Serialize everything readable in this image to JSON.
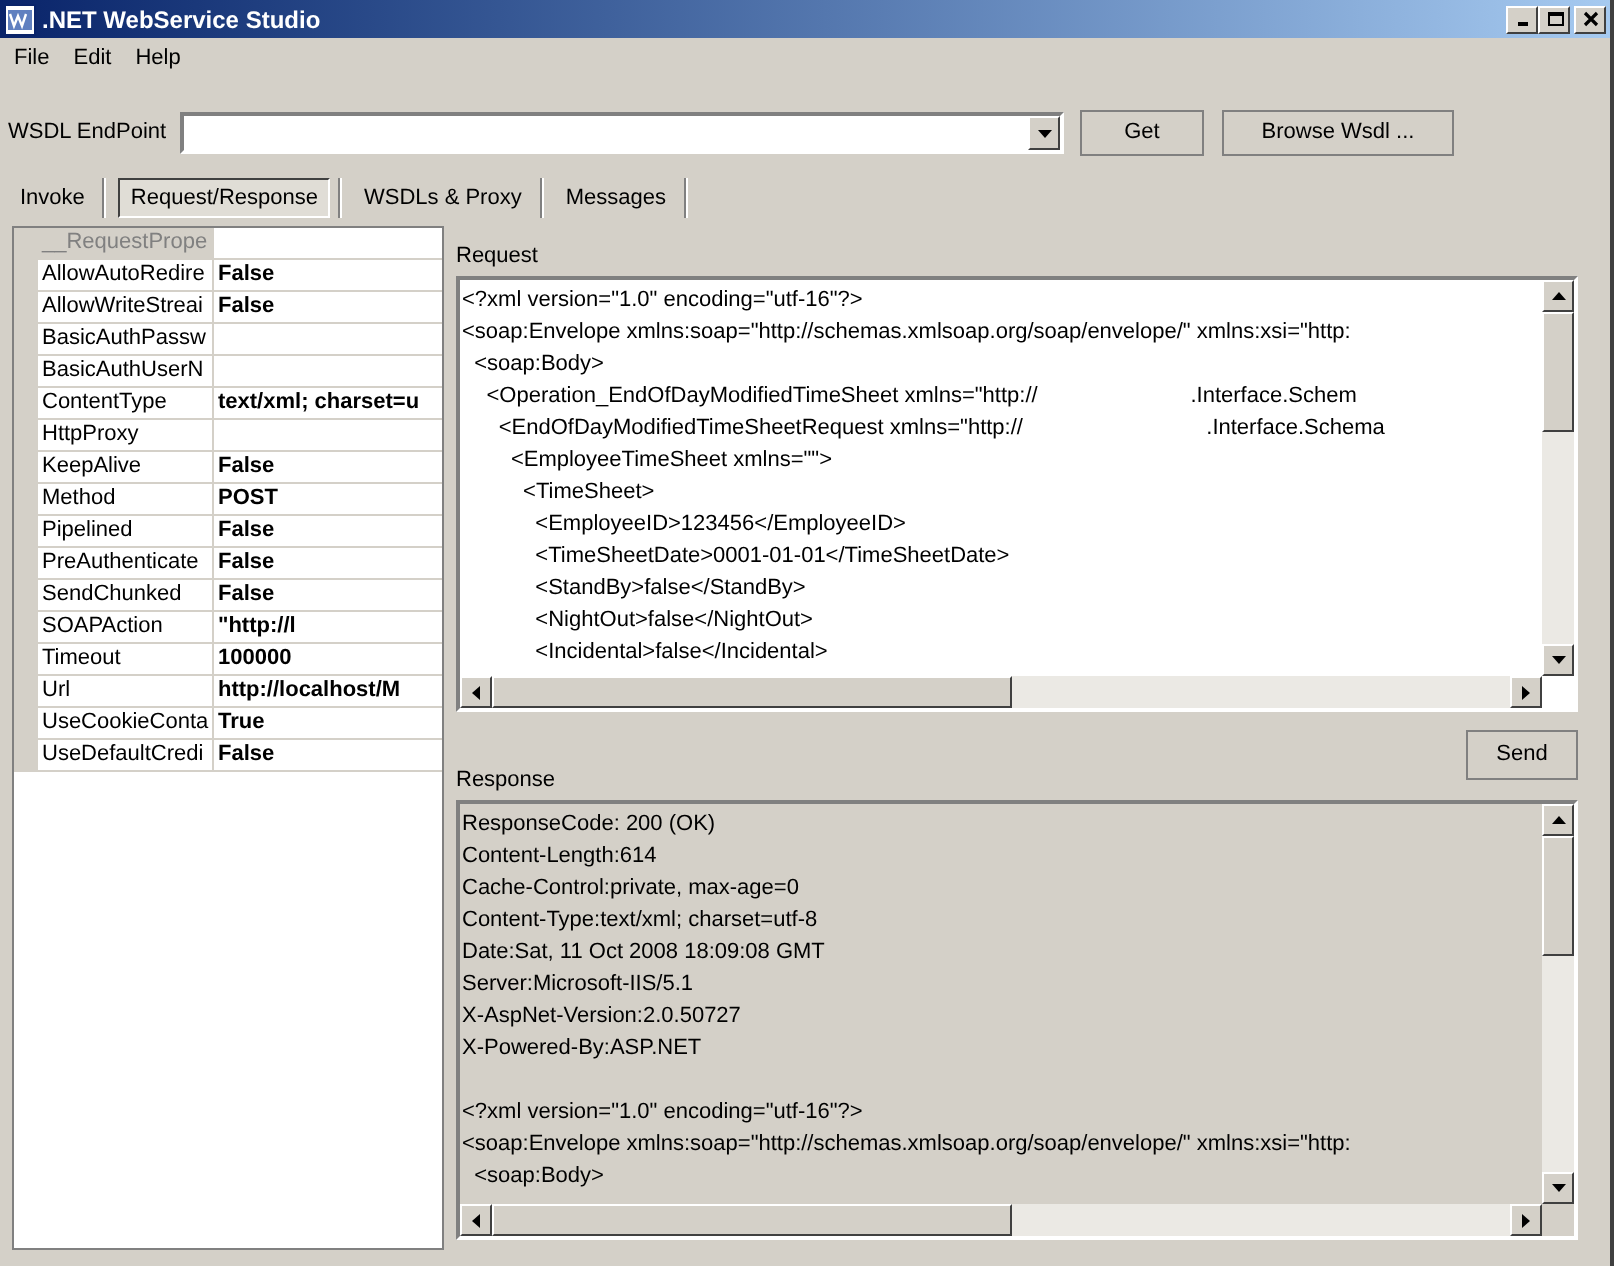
{
  "window": {
    "title": ".NET WebService Studio"
  },
  "menu": [
    "File",
    "Edit",
    "Help"
  ],
  "endpoint": {
    "label": "WSDL EndPoint",
    "buttons": [
      "Get",
      "Browse Wsdl ..."
    ]
  },
  "tabs": [
    {
      "label": "Invoke",
      "selected": false
    },
    {
      "label": "Request/Response",
      "selected": true
    },
    {
      "label": "WSDLs & Proxy",
      "selected": false
    },
    {
      "label": "Messages",
      "selected": false
    }
  ],
  "properties": [
    {
      "name": "__RequestPrope",
      "disabled": true
    },
    {
      "name": "AllowAutoRedire",
      "value": "False",
      "disabled": false
    },
    {
      "name": "AllowWriteStreai",
      "value": "False",
      "disabled": false
    },
    {
      "name": "BasicAuthPassw",
      "disabled": false
    },
    {
      "name": "BasicAuthUserN",
      "disabled": false
    },
    {
      "name": "ContentType",
      "value": "text/xml; charset=u",
      "disabled": false
    },
    {
      "name": "HttpProxy",
      "disabled": false
    },
    {
      "name": "KeepAlive",
      "value": "False",
      "disabled": false
    },
    {
      "name": "Method",
      "value": "POST",
      "disabled": false
    },
    {
      "name": "Pipelined",
      "value": "False",
      "disabled": false
    },
    {
      "name": "PreAuthenticate",
      "value": "False",
      "disabled": false
    },
    {
      "name": "SendChunked",
      "value": "False",
      "disabled": false
    },
    {
      "name": "SOAPAction",
      "value": "\"http://l",
      "disabled": false
    },
    {
      "name": "Timeout",
      "value": "100000",
      "disabled": false
    },
    {
      "name": "Url",
      "value": "http://localhost/M",
      "disabled": false
    },
    {
      "name": "UseCookieConta",
      "value": "True",
      "disabled": false
    },
    {
      "name": "UseDefaultCredi",
      "value": "False",
      "disabled": false
    }
  ],
  "request": {
    "label": "Request",
    "lines": [
      "<?xml version=\"1.0\" encoding=\"utf-16\"?>",
      "<soap:Envelope xmlns:soap=\"http://schemas.xmlsoap.org/soap/envelope/\" xmlns:xsi=\"http:",
      "  <soap:Body>",
      "    <Operation_EndOfDayModifiedTimeSheet xmlns=\"http://                         .Interface.Schem",
      "      <EndOfDayModifiedTimeSheetRequest xmlns=\"http://                              .Interface.Schema",
      "        <EmployeeTimeSheet xmlns=\"\">",
      "          <TimeSheet>",
      "            <EmployeeID>123456</EmployeeID>",
      "            <TimeSheetDate>0001-01-01</TimeSheetDate>",
      "            <StandBy>false</StandBy>",
      "            <NightOut>false</NightOut>",
      "            <Incidental>false</Incidental>"
    ]
  },
  "response": {
    "label": "Response",
    "button": "Send",
    "headers": [
      "ResponseCode: 200 (OK)",
      "Content-Length:614",
      "Cache-Control:private, max-age=0",
      "Content-Type:text/xml; charset=utf-8",
      "Date:Sat, 11 Oct 2008 18:09:08 GMT",
      "Server:Microsoft-IIS/5.1",
      "X-AspNet-Version:2.0.50727",
      "X-Powered-By:ASP.NET"
    ],
    "body": [
      "<?xml version=\"1.0\" encoding=\"utf-16\"?>",
      "<soap:Envelope xmlns:soap=\"http://schemas.xmlsoap.org/soap/envelope/\" xmlns:xsi=\"http:",
      "  <soap:Body>"
    ]
  }
}
